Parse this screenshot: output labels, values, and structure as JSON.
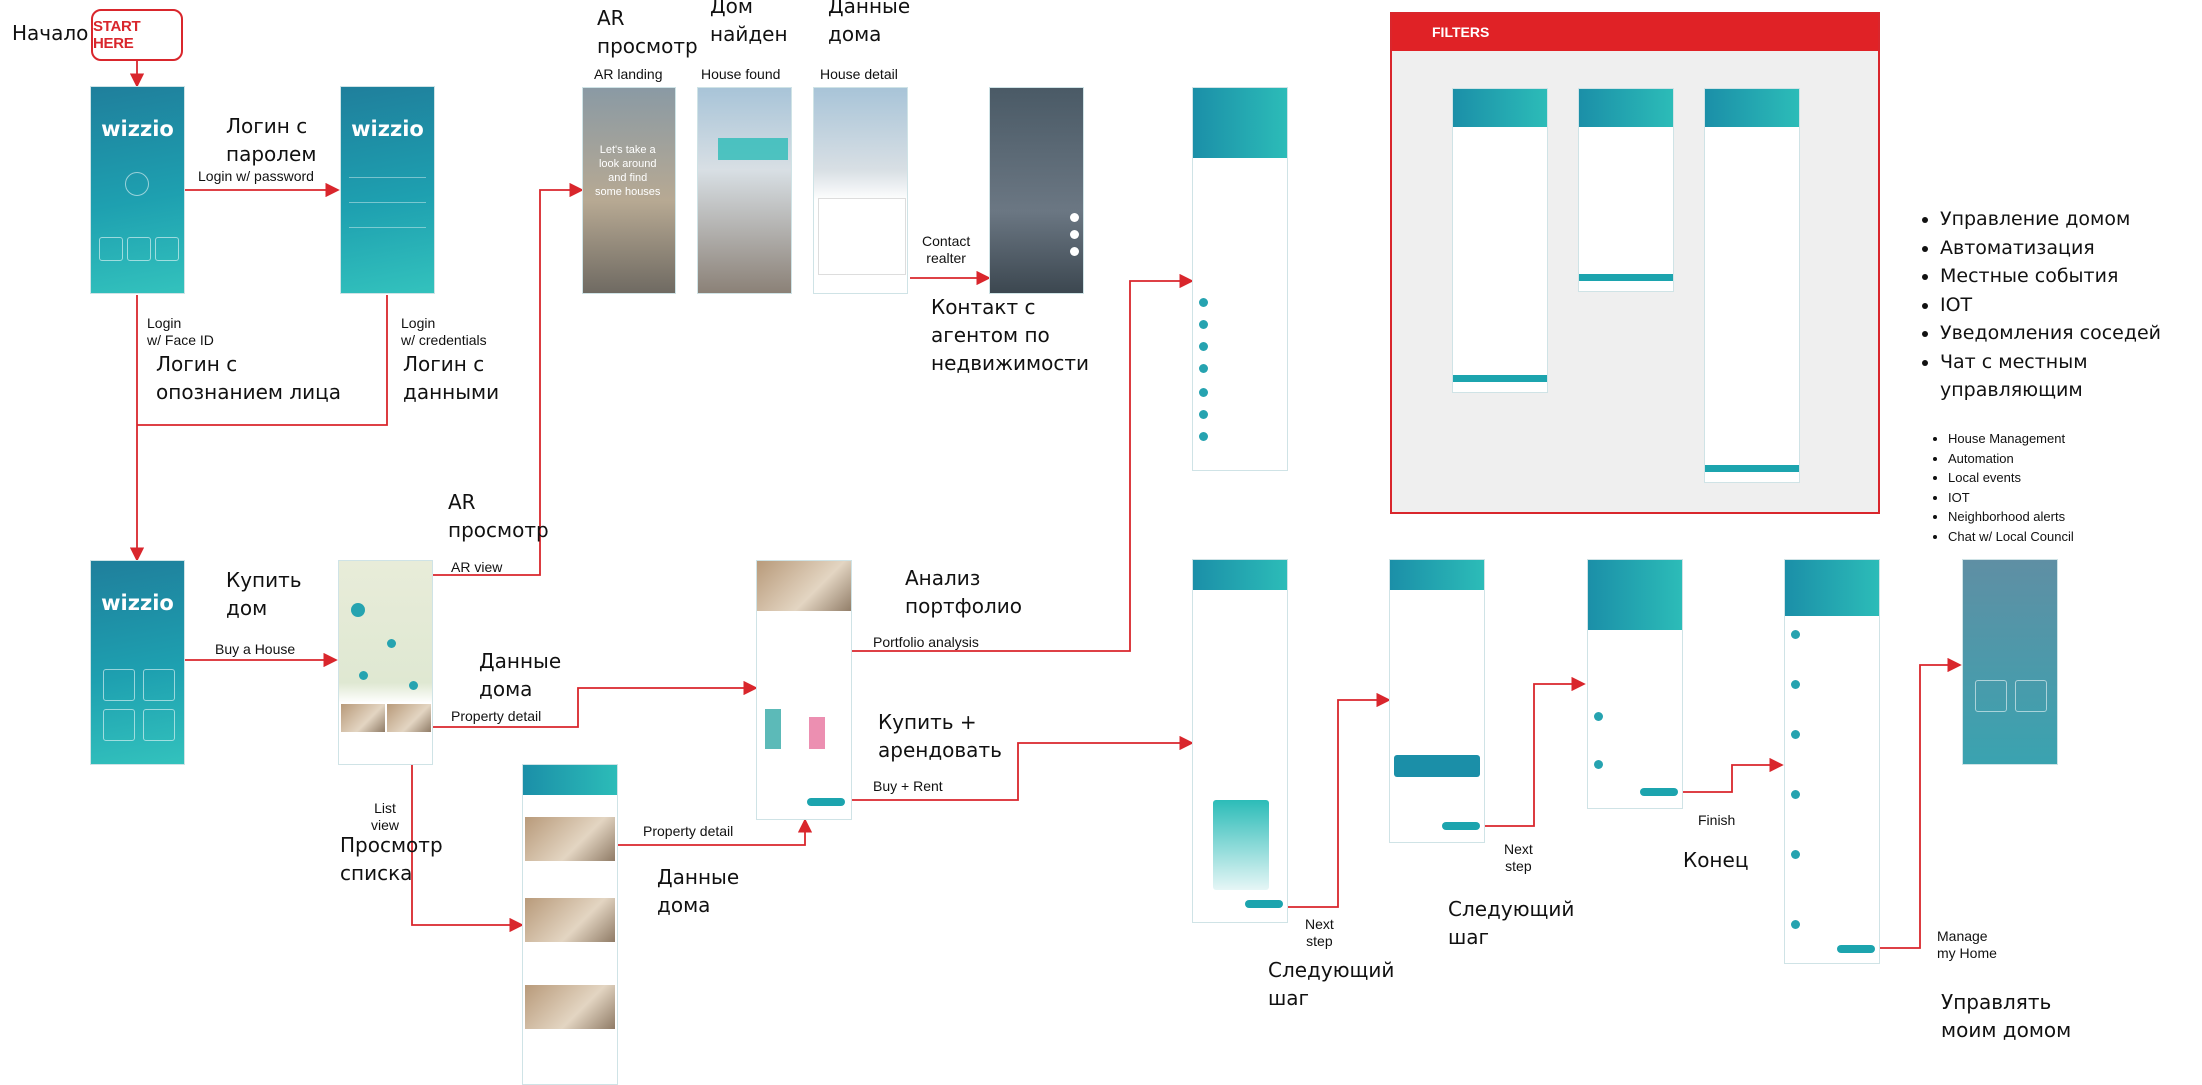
{
  "start": {
    "ru": "Начало",
    "button": "START HERE"
  },
  "login": {
    "logo": "wizzio",
    "password_ru": "Логин с\nпаролем",
    "password_en": "Login w/ password",
    "faceid_en": "Login\nw/ Face ID",
    "faceid_ru": "Логин с\nопознанием лица",
    "credentials_en": "Login\nw/ credentials",
    "credentials_ru": "Логин с\nданными"
  },
  "ar": {
    "ru": "AR\nпросмотр",
    "landing_en": "AR landing",
    "found_ru": "Дом\nнайден",
    "found_en": "House found",
    "detail_ru": "Данные\nдома",
    "detail_en": "House detail",
    "contact_en": "Contact\nrealter",
    "contact_ru": "Контакт с\nагентом по\nнедвижимости",
    "view_ru": "AR\nпросмотр",
    "view_en": "AR view",
    "landing_overlay": "Let's take a\nlook around\nand find\nsome houses"
  },
  "buy": {
    "ru": "Купить\nдом",
    "en": "Buy a House",
    "property_ru": "Данные\nдома",
    "property_en": "Property detail",
    "list_en": "List\nview",
    "list_ru": "Просмотр\nсписка",
    "property2_en": "Property detail",
    "property2_ru": "Данные\nдома"
  },
  "portfolio": {
    "ru": "Анализ\nпортфолио",
    "en": "Portfolio analysis"
  },
  "buyrent": {
    "ru": "Купить +\nарендовать",
    "en": "Buy + Rent"
  },
  "steps": {
    "next1_en": "Next\nstep",
    "next1_ru": "Следующий\nшаг",
    "next2_en": "Next\nstep",
    "next2_ru": "Следующий\nшаг",
    "finish_en": "Finish",
    "finish_ru": "Конец",
    "manage_en": "Manage\nmy Home",
    "manage_ru": "Управлять\nмоим домом"
  },
  "filters": {
    "title": "FILTERS"
  },
  "features_ru": [
    "Управление домом",
    "Автоматизация",
    "Местные события",
    "IOT",
    "Уведомления соседей",
    "Чат с местным управляющим"
  ],
  "features_en": [
    "House Management",
    "Automation",
    "Local events",
    "IOT",
    "Neighborhood alerts",
    "Chat w/ Local Council"
  ],
  "colors": {
    "accent": "#d9262c",
    "teal": "#1ea0b0",
    "filters_header": "#e02226"
  }
}
